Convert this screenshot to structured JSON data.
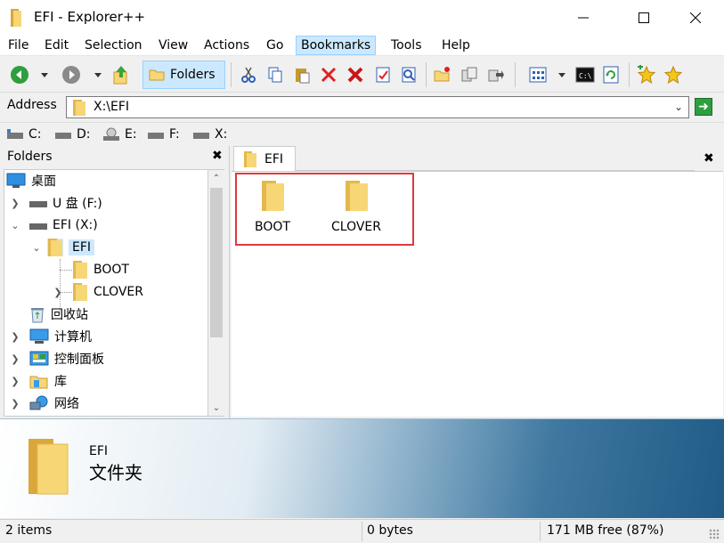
{
  "window": {
    "title": "EFI - Explorer++"
  },
  "menu": [
    "File",
    "Edit",
    "Selection",
    "View",
    "Actions",
    "Go",
    "Bookmarks",
    "Tools",
    "Help"
  ],
  "menu_active": "Bookmarks",
  "toolbar": {
    "folders_label": "Folders"
  },
  "address": {
    "label": "Address",
    "value": "X:\\EFI"
  },
  "drives": [
    "C:",
    "D:",
    "E:",
    "F:",
    "X:"
  ],
  "folders_pane": {
    "title": "Folders",
    "tree": [
      {
        "label": "桌面",
        "icon": "desktop-icon"
      },
      {
        "label": "U 盘 (F:)",
        "icon": "drive-icon"
      },
      {
        "label": "EFI (X:)",
        "icon": "drive-icon"
      },
      {
        "label": "EFI",
        "icon": "folder-icon",
        "selected": true
      },
      {
        "label": "BOOT",
        "icon": "folder-icon"
      },
      {
        "label": "CLOVER",
        "icon": "folder-icon"
      },
      {
        "label": "回收站",
        "icon": "recycle-bin-icon"
      },
      {
        "label": "计算机",
        "icon": "computer-icon"
      },
      {
        "label": "控制面板",
        "icon": "control-panel-icon"
      },
      {
        "label": "库",
        "icon": "library-icon"
      },
      {
        "label": "网络",
        "icon": "network-icon"
      }
    ]
  },
  "tab": {
    "label": "EFI"
  },
  "files": [
    {
      "name": "BOOT"
    },
    {
      "name": "CLOVER"
    }
  ],
  "display": {
    "name": "EFI",
    "type": "文件夹"
  },
  "status": {
    "items": "2 items",
    "size": "0 bytes",
    "free": "171 MB free (87%)"
  },
  "colors": {
    "selection": "#cce8ff",
    "highlight_frame": "#e0393e",
    "folder": "#f7d676"
  }
}
